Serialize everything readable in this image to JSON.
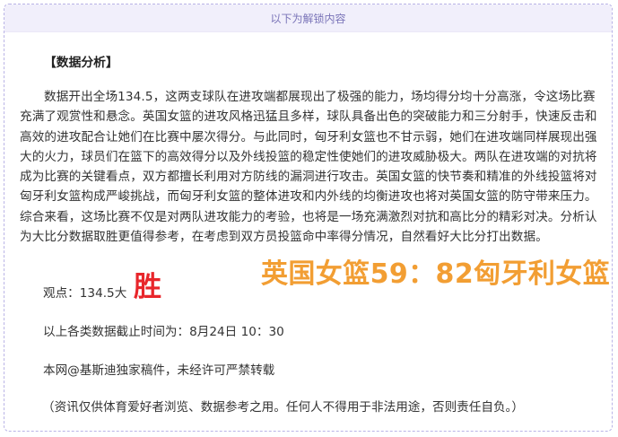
{
  "header": {
    "locked_label": "以下为解锁内容"
  },
  "article": {
    "heading": "【数据分析】",
    "paragraph": "数据开出全场134.5，这两支球队在进攻端都展现出了极强的能力，场均得分均十分高涨，令这场比赛充满了观赏性和悬念。英国女篮的进攻风格迅猛且多样，球队具备出色的突破能力和三分射手，快速反击和高效的进攻配合让她们在比赛中屡次得分。与此同时，匈牙利女篮也不甘示弱，她们在进攻端同样展现出强大的火力，球员们在篮下的高效得分以及外线投篮的稳定性使她们的进攻威胁极大。两队在进攻端的对抗将成为比赛的关键看点，双方都擅长利用对方防线的漏洞进行攻击。英国女篮的快节奏和精准的外线投篮将对匈牙利女篮构成严峻挑战，而匈牙利女篮的整体进攻和内外线的均衡进攻也将对英国女篮的防守带来压力。综合来看，这场比赛不仅是对两队进攻能力的考验，也将是一场充满激烈对抗和高比分的精彩对决。分析认为大比分数据取胜更值得参考，在考虑到双方员投篮命中率得分情况，自然看好大比分打出数据。",
    "verdict_label": "观点：134.5大",
    "verdict_result": "胜",
    "score_line": "英国女篮59：82匈牙利女篮",
    "deadline": "以上各类数据截止时间为：8月24日 10：30",
    "copyright": "本网@基斯迪独家稿件，未经许可严禁转载",
    "disclaimer": "（资讯仅供体育爱好者浏览、数据参考之用。任何人不得用于非法用途，否则责任自负。）"
  },
  "colors": {
    "header_bg": "#f1effb",
    "header_text": "#7a74b8",
    "border": "#b9b3e6",
    "verdict_red": "#e8262b",
    "score_orange": "#f29e33"
  }
}
